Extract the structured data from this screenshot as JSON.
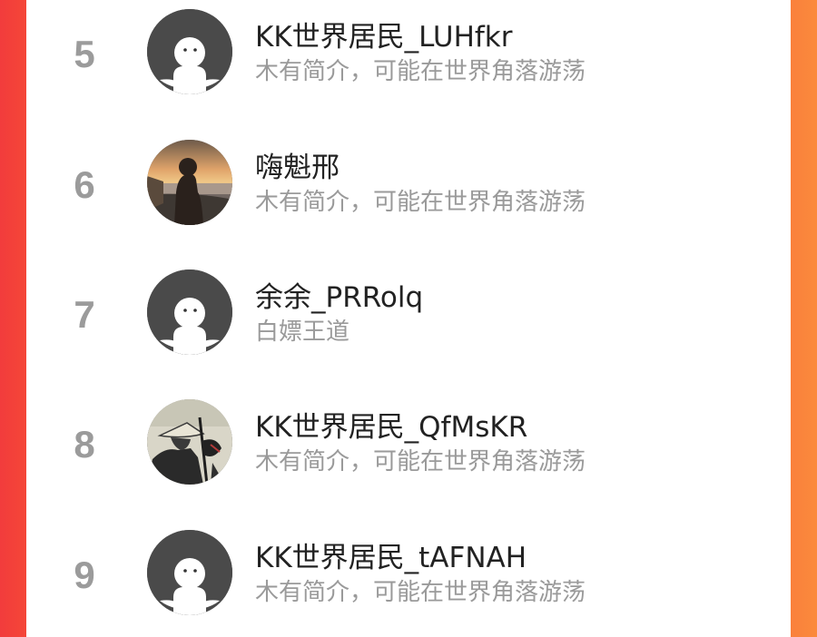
{
  "ranking": {
    "items": [
      {
        "rank": "5",
        "name": "KK世界居民_LUHfkr",
        "bio": "木有简介，可能在世界角落游荡",
        "avatar": "default-person-icon"
      },
      {
        "rank": "6",
        "name": "嗨魁邢",
        "bio": "木有简介，可能在世界角落游荡",
        "avatar": "sunset-photo-avatar"
      },
      {
        "rank": "7",
        "name": "余余_PRRolq",
        "bio": "白嫖王道",
        "avatar": "default-person-icon"
      },
      {
        "rank": "8",
        "name": "KK世界居民_QfMsKR",
        "bio": "木有简介，可能在世界角落游荡",
        "avatar": "swordsman-art-avatar"
      },
      {
        "rank": "9",
        "name": "KK世界居民_tAFNAH",
        "bio": "木有简介，可能在世界角落游荡",
        "avatar": "default-person-icon"
      }
    ]
  },
  "colors": {
    "background_left": "#f23c3c",
    "background_right": "#fb8a3c",
    "rank_text": "#9b9b9b",
    "name_text": "#222222",
    "bio_text": "#9a9a9a",
    "default_avatar_bg": "#4a4a4a"
  }
}
